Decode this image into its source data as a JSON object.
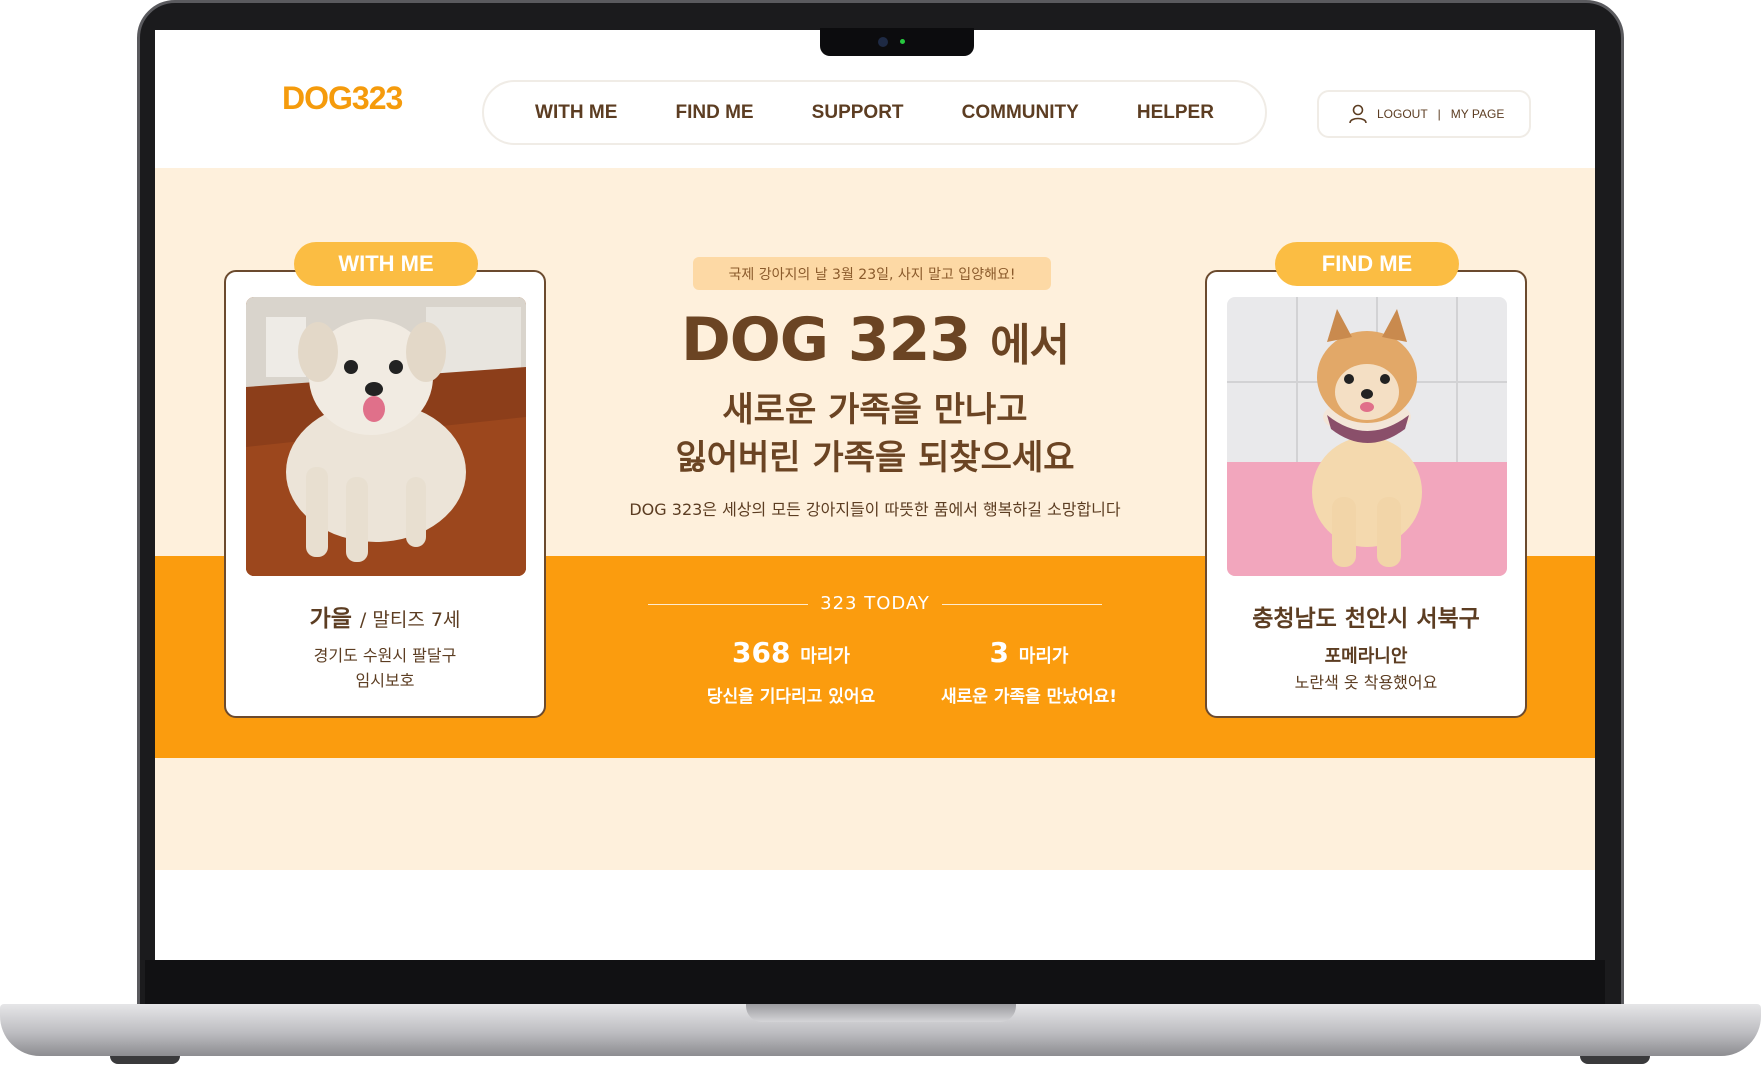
{
  "header": {
    "logo_text": "DOG323",
    "nav": [
      {
        "label": "WITH ME"
      },
      {
        "label": "FIND ME"
      },
      {
        "label": "SUPPORT"
      },
      {
        "label": "COMMUNITY"
      },
      {
        "label": "HELPER"
      }
    ],
    "logout_label": "LOGOUT",
    "separator": "|",
    "mypage_label": "MY PAGE"
  },
  "hero": {
    "notice": "국제 강아지의 날 3월 23일, 사지 말고 입양해요!",
    "title_main": "DOG 323",
    "title_suffix": "에서",
    "line2": "새로운 가족을 만나고",
    "line3": "잃어버린 가족을 되찾으세요",
    "description": "DOG 323은 세상의 모든 강아지들이 따뜻한 품에서 행복하길 소망합니다"
  },
  "today": {
    "label": "323 TODAY",
    "stats": [
      {
        "number": "368",
        "unit": "마리가",
        "caption": "당신을 기다리고 있어요"
      },
      {
        "number": "3",
        "unit": "마리가",
        "caption": "새로운 가족을 만났어요!"
      }
    ]
  },
  "with_me_card": {
    "tag": "WITH ME",
    "name": "가을",
    "breed_age": "/ 말티즈 7세",
    "location": "경기도 수원시 팔달구",
    "status": "임시보호"
  },
  "find_me_card": {
    "tag": "FIND ME",
    "region": "충청남도 천안시 서북구",
    "breed": "포메라니안",
    "description": "노란색 옷 착용했어요"
  },
  "colors": {
    "accent_orange": "#fb9c0e",
    "tag_yellow": "#fbbd43",
    "cream": "#fef0dc",
    "brown_text": "#5c3d22"
  }
}
